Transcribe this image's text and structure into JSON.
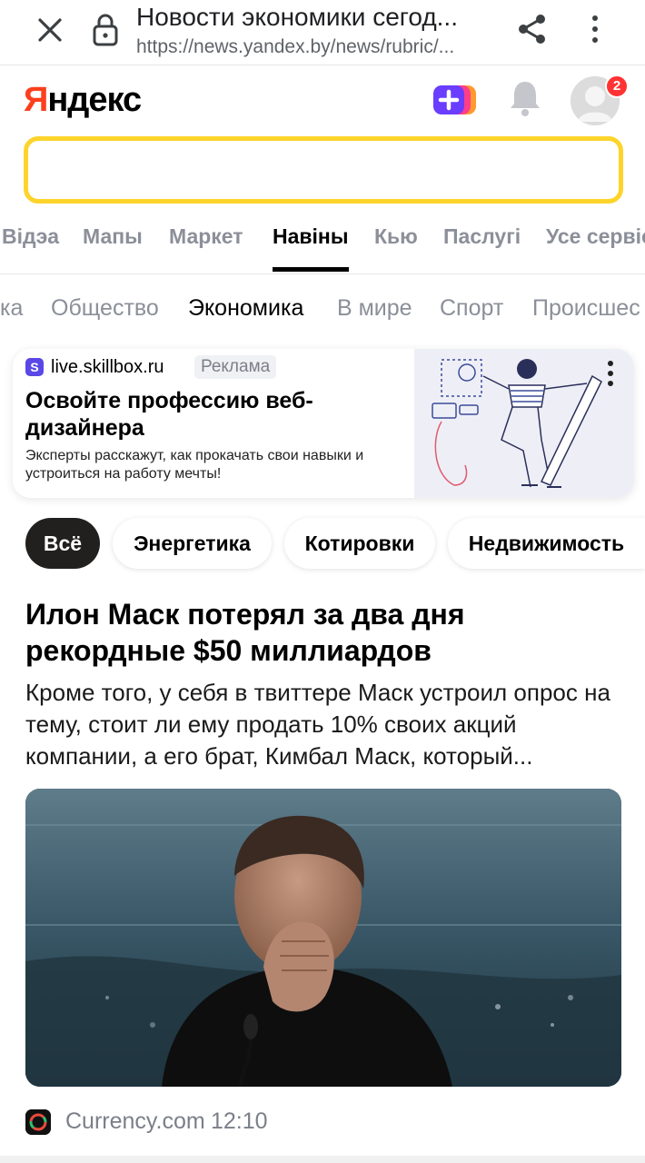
{
  "browser": {
    "title": "Новости экономики сегод...",
    "url": "https://news.yandex.by/news/rubric/..."
  },
  "header": {
    "logo": {
      "first_letter": "Я",
      "rest": "ндекс"
    },
    "notification_count": "2",
    "search_value": "",
    "brand_colors": {
      "logo_red": "#fc3f1d",
      "search_border": "#fed42b",
      "badge": "#ff3333"
    }
  },
  "services": [
    {
      "label": "Відэа",
      "active": false
    },
    {
      "label": "Мапы",
      "active": false
    },
    {
      "label": "Маркет",
      "active": false
    },
    {
      "label": "Навіны",
      "active": true
    },
    {
      "label": "Кью",
      "active": false
    },
    {
      "label": "Паслугі",
      "active": false
    },
    {
      "label": "Усе сервіс",
      "active": false
    }
  ],
  "rubrics": [
    {
      "label": "ка",
      "active": false
    },
    {
      "label": "Общество",
      "active": false
    },
    {
      "label": "Экономика",
      "active": true
    },
    {
      "label": "В мире",
      "active": false
    },
    {
      "label": "Спорт",
      "active": false
    },
    {
      "label": "Происшес",
      "active": false
    }
  ],
  "ad": {
    "favicon_letter": "S",
    "domain": "live.skillbox.ru",
    "label": "Реклама",
    "title": "Освойте профессию веб-дизайнера",
    "description": "Эксперты расскажут, как прокачать свои навыки и устроиться на работу мечты!"
  },
  "chips": [
    {
      "label": "Всё",
      "active": true
    },
    {
      "label": "Энергетика",
      "active": false
    },
    {
      "label": "Котировки",
      "active": false
    },
    {
      "label": "Недвижимость",
      "active": false
    }
  ],
  "story": {
    "title": "Илон Маск потерял за два дня рекордные $50 миллиардов",
    "snippet": "Кроме того, у себя в твиттере Маск устроил опрос на тему, стоит ли ему продать 10% своих акций компании, а его брат, Кимбал Маск, который...",
    "source": "Currency.com",
    "time": "12:10"
  }
}
